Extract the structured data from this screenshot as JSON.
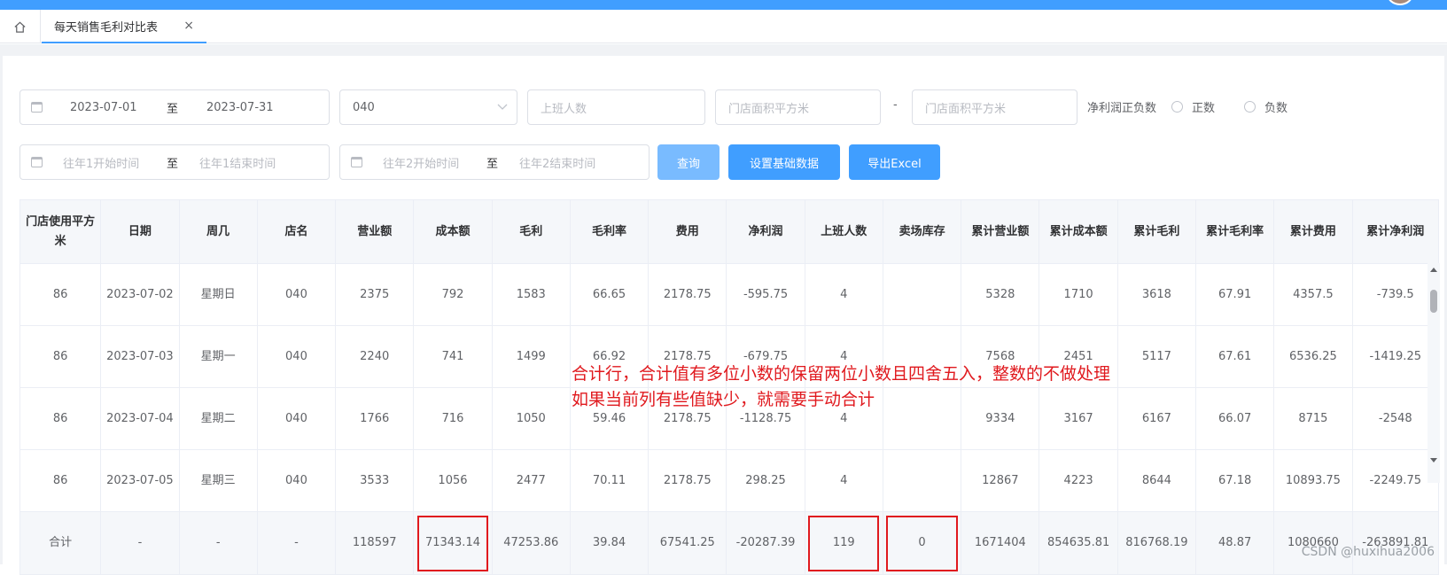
{
  "tabs": {
    "home_icon": "home-icon",
    "active_label": "每天销售毛利对比表",
    "close": "×"
  },
  "filters": {
    "date_start": "2023-07-01",
    "date_sep": "至",
    "date_end": "2023-07-31",
    "store_value": "040",
    "staff_placeholder": "上班人数",
    "area_min_placeholder": "门店面积平方米",
    "area_dash": "-",
    "area_max_placeholder": "门店面积平方米",
    "profit_sign_label": "净利润正负数",
    "positive_label": "正数",
    "negative_label": "负数",
    "y1_start_placeholder": "往年1开始时间",
    "y1_sep": "至",
    "y1_end_placeholder": "往年1结束时间",
    "y2_start_placeholder": "往年2开始时间",
    "y2_sep": "至",
    "y2_end_placeholder": "往年2结束时间",
    "query_label": "查询",
    "setup_label": "设置基础数据",
    "export_label": "导出Excel"
  },
  "table": {
    "headers": [
      "门店使用平方米",
      "日期",
      "周几",
      "店名",
      "营业额",
      "成本额",
      "毛利",
      "毛利率",
      "费用",
      "净利润",
      "上班人数",
      "卖场库存",
      "累计营业额",
      "累计成本额",
      "累计毛利",
      "累计毛利率",
      "累计费用",
      "累计净利润"
    ],
    "rows": [
      [
        "86",
        "2023-07-02",
        "星期日",
        "040",
        "2375",
        "792",
        "1583",
        "66.65",
        "2178.75",
        "-595.75",
        "4",
        "",
        "5328",
        "1710",
        "3618",
        "67.91",
        "4357.5",
        "-739.5"
      ],
      [
        "86",
        "2023-07-03",
        "星期一",
        "040",
        "2240",
        "741",
        "1499",
        "66.92",
        "2178.75",
        "-679.75",
        "4",
        "",
        "7568",
        "2451",
        "5117",
        "67.61",
        "6536.25",
        "-1419.25"
      ],
      [
        "86",
        "2023-07-04",
        "星期二",
        "040",
        "1766",
        "716",
        "1050",
        "59.46",
        "2178.75",
        "-1128.75",
        "4",
        "",
        "9334",
        "3167",
        "6167",
        "66.07",
        "8715",
        "-2548"
      ],
      [
        "86",
        "2023-07-05",
        "星期三",
        "040",
        "3533",
        "1056",
        "2477",
        "70.11",
        "2178.75",
        "298.25",
        "4",
        "",
        "12867",
        "4223",
        "8644",
        "67.18",
        "10893.75",
        "-2249.75"
      ]
    ],
    "summary": [
      "合计",
      "-",
      "-",
      "-",
      "118597",
      "71343.14",
      "47253.86",
      "39.84",
      "67541.25",
      "-20287.39",
      "119",
      "0",
      "1671404",
      "854635.81",
      "816768.19",
      "48.87",
      "1080660",
      "-263891.81"
    ]
  },
  "annotation": {
    "line1": "合计行，合计值有多位小数的保留两位小数且四舍五入，整数的不做处理",
    "line2": "如果当前列有些值缺少，就需要手动合计"
  },
  "watermark": "CSDN @huxihua2006",
  "colors": {
    "primary": "#409eff",
    "primary_light": "#79bbff",
    "highlight": "#e0191e"
  }
}
